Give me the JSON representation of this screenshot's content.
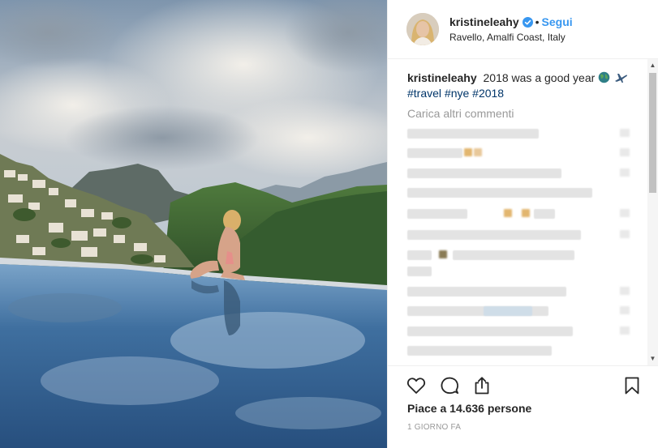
{
  "post": {
    "username": "kristineleahy",
    "follow_label": "Segui",
    "separator": "•",
    "location": "Ravello, Amalfi Coast, Italy",
    "caption_text": "2018 was a good year",
    "caption_emojis": [
      "globe-icon",
      "airplane-icon"
    ],
    "hashtags": "#travel #nye #2018",
    "load_more_label": "Carica altri commenti",
    "likes_text": "Piace a 14.636 persone",
    "time_ago": "1 GIORNO FA"
  },
  "icons": {
    "verified": "verified-badge-icon",
    "like": "heart-icon",
    "comment": "comment-icon",
    "share": "share-icon",
    "save": "bookmark-icon"
  },
  "colors": {
    "link_blue": "#3897f0",
    "hashtag_blue": "#003569",
    "text": "#262626",
    "muted": "#999999",
    "divider": "#efefef"
  }
}
